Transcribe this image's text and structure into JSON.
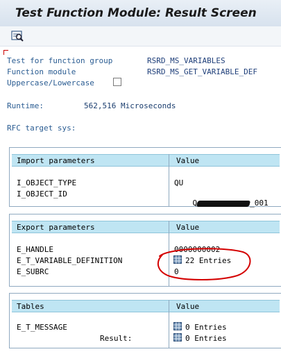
{
  "window": {
    "title": "Test Function Module: Result Screen"
  },
  "toolbar": {
    "icon": "display-icon"
  },
  "header": {
    "function_group_label": "Test for function group",
    "function_group_value": "RSRD_MS_VARIABLES",
    "function_module_label": "Function module",
    "function_module_value": "RSRD_MS_GET_VARIABLE_DEF",
    "case_label": "Uppercase/Lowercase",
    "case_checked": false,
    "runtime_label": "Runtime:",
    "runtime_value": "562,516 Microseconds",
    "rfc_label": "RFC target sys:"
  },
  "import": {
    "col1": "Import parameters",
    "col2": "Value",
    "rows": [
      {
        "name": "I_OBJECT_TYPE",
        "value": "QU"
      },
      {
        "name": "I_OBJECT_ID",
        "value_prefix": "Q",
        "value_suffix": "_001"
      }
    ]
  },
  "export": {
    "col1": "Export parameters",
    "col2": "Value",
    "rows": [
      {
        "name": "E_HANDLE",
        "value": "0000000002"
      },
      {
        "name": "E_T_VARIABLE_DEFINITION",
        "value": "22 Entries"
      },
      {
        "name": "E_SUBRC",
        "value": "0"
      }
    ]
  },
  "tables": {
    "col1": "Tables",
    "col2": "Value",
    "rows": [
      {
        "name": "E_T_MESSAGE",
        "value": "0 Entries"
      },
      {
        "name": "Result:",
        "value": "0 Entries"
      }
    ]
  },
  "colors": {
    "header_band": "#bfe5f3",
    "annotation": "#d40000",
    "label_blue": "#2a5c92"
  }
}
